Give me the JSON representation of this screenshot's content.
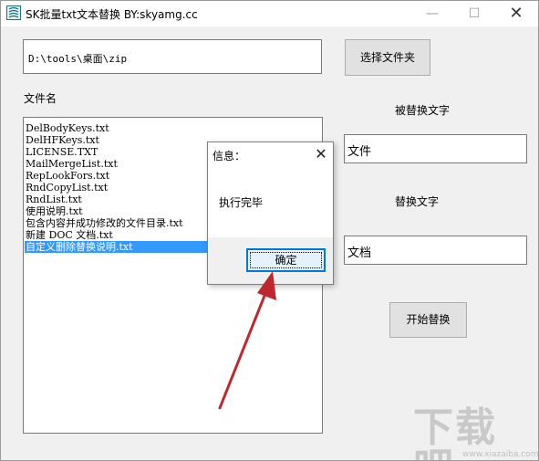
{
  "window": {
    "title": "SK批量txt文本替换 BY:skyamg.cc",
    "controls": {
      "minimize": "—",
      "maximize": "☐",
      "close": "✕"
    }
  },
  "path": {
    "value": "D:\\tools\\桌面\\zip"
  },
  "buttons": {
    "choose_folder": "选择文件夹",
    "start_replace": "开始替换"
  },
  "labels": {
    "filename": "文件名",
    "find_text": "被替换文字",
    "replace_text": "替换文字"
  },
  "files": [
    "DelBodyKeys.txt",
    "DelHFKeys.txt",
    "LICENSE.TXT",
    "MailMergeList.txt",
    "RepLookFors.txt",
    "RndCopyList.txt",
    "RndList.txt",
    "使用说明.txt",
    "包含内容并成功修改的文件目录.txt",
    "新建 DOC 文档.txt",
    "自定义删除替换说明.txt"
  ],
  "selected_file_index": 10,
  "fields": {
    "find_value": "文件",
    "replace_value": "文档"
  },
  "dialog": {
    "title": "信息：",
    "close": "✕",
    "message": "执行完毕",
    "ok": "确定"
  },
  "watermark": {
    "brand": "下载吧",
    "url": "www.xiazaiba.com"
  },
  "colors": {
    "selection": "#3399ff",
    "dialog_focus": "#0078d7",
    "annotation_arrow": "#c0272d"
  }
}
